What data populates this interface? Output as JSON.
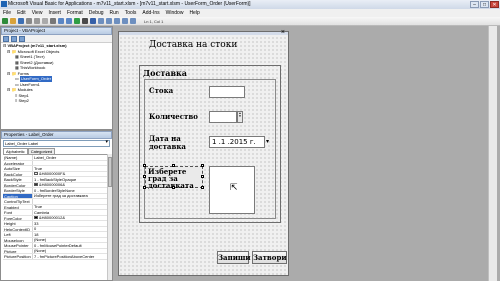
{
  "window": {
    "title": "Microsoft Visual Basic for Applications - m7v11_start.xlsm - [m7v11_start.xlsm - UserForm_Order (UserForm)]"
  },
  "menu": [
    "File",
    "Edit",
    "View",
    "Insert",
    "Format",
    "Debug",
    "Run",
    "Tools",
    "Add-Ins",
    "Window",
    "Help"
  ],
  "toolbar": {
    "status": "Ln 1, Col 1"
  },
  "project": {
    "title": "Project - VBAProject",
    "tree": [
      "VBAProject (m7v11_start.xlsm)",
      "Microsoft Excel Objects",
      "Sheet1 (Тест)",
      "Sheet2 (Доставки)",
      "ThisWorkbook",
      "Forms",
      "UserForm_Order",
      "UserForm1",
      "Modules",
      "Step1",
      "Step2"
    ]
  },
  "properties": {
    "title": "Properties - Label_Order",
    "object": "Label_Order Label",
    "tabs": [
      "Alphabetic",
      "Categorized"
    ],
    "rows": [
      [
        "(Name)",
        "Label_Order"
      ],
      [
        "Accelerator",
        ""
      ],
      [
        "AutoSize",
        "True"
      ],
      [
        "BackColor",
        "&H8000000F&"
      ],
      [
        "BackStyle",
        "1 - fmBackStyleOpaque"
      ],
      [
        "BorderColor",
        "&H80000006&"
      ],
      [
        "BorderStyle",
        "0 - fmBorderStyleNone"
      ],
      [
        "Caption",
        "Изберете град за доставката"
      ],
      [
        "ControlTipText",
        ""
      ],
      [
        "Enabled",
        "True"
      ],
      [
        "Font",
        "Cambria"
      ],
      [
        "ForeColor",
        "&H80000012&"
      ],
      [
        "Height",
        "33"
      ],
      [
        "HelpContextID",
        "0"
      ],
      [
        "Left",
        "18"
      ],
      [
        "MouseIcon",
        "(None)"
      ],
      [
        "MousePointer",
        "0 - fmMousePointerDefault"
      ],
      [
        "Picture",
        "(None)"
      ],
      [
        "PicturePosition",
        "7 - fmPicturePositionAboveCenter"
      ]
    ]
  },
  "form": {
    "title": "Доставка на стоки",
    "frame_caption": "Доставка",
    "labels": {
      "quantity_sum": "Стока",
      "amount": "Количество",
      "date": "Дата на доставка",
      "city": "Изберете град за доставката"
    },
    "date_value": "1 .1 .2015 г.",
    "buttons": {
      "save": "Запиши",
      "close": "Затвори"
    }
  },
  "colors": {
    "selection": "#316ac5",
    "form_bg": "#f0f0f0",
    "close_btn": "#c9463d"
  }
}
